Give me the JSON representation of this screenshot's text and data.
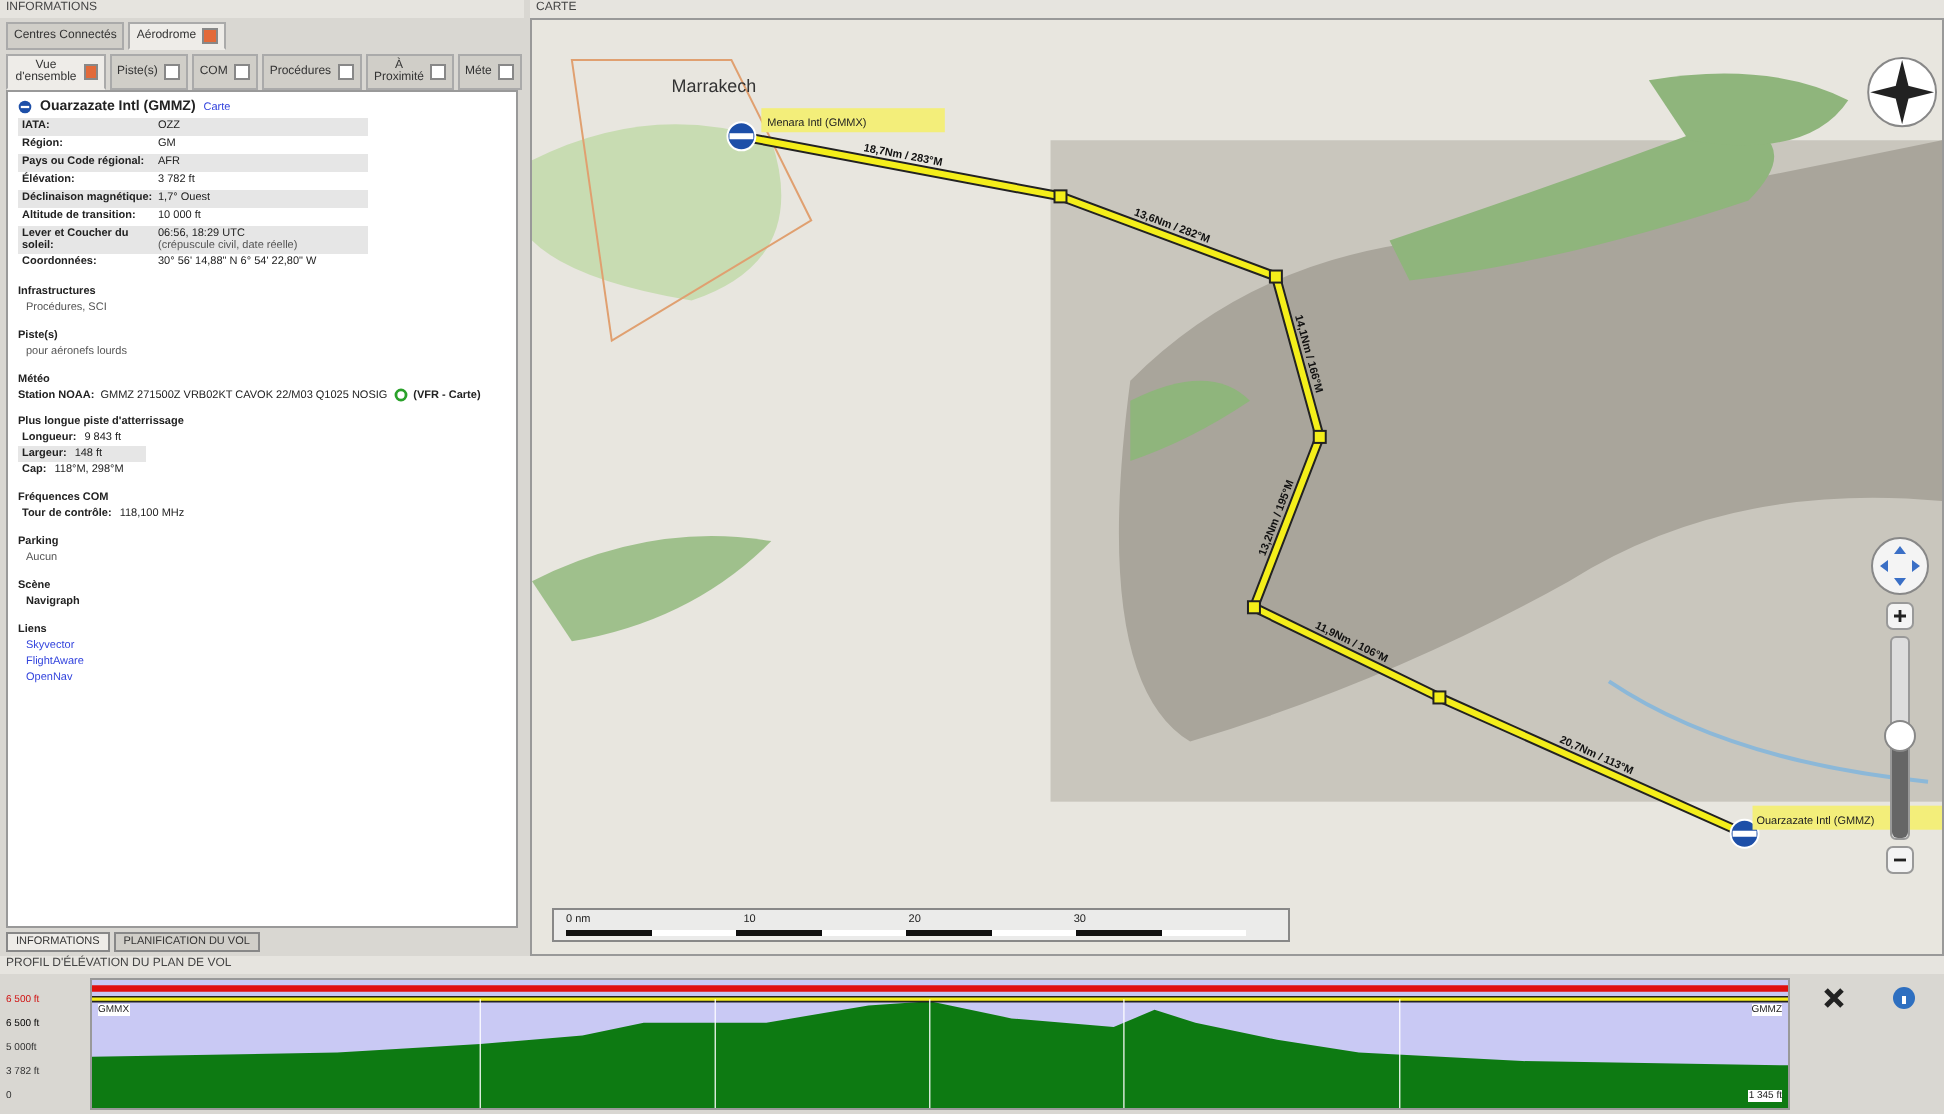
{
  "info_panel": {
    "title": "INFORMATIONS",
    "tabs": [
      {
        "label": "Centres Connectés",
        "selected": false
      },
      {
        "label": "Aérodrome",
        "selected": true
      }
    ],
    "subtabs": [
      {
        "label": "Vue d'ensemble",
        "selected": true
      },
      {
        "label": "Piste(s)",
        "selected": false
      },
      {
        "label": "COM",
        "selected": false
      },
      {
        "label": "Procédures",
        "selected": false
      },
      {
        "label": "À Proximité",
        "selected": false
      },
      {
        "label": "Méte",
        "selected": false
      }
    ],
    "airport": {
      "name": "Ouarzazate Intl (GMMZ)",
      "link": "Carte"
    },
    "rows": [
      {
        "label": "IATA:",
        "value": "OZZ"
      },
      {
        "label": "Région:",
        "value": "GM"
      },
      {
        "label": "Pays ou Code régional:",
        "value": "AFR"
      },
      {
        "label": "Élévation:",
        "value": "3 782 ft"
      },
      {
        "label": "Déclinaison magnétique:",
        "value": "1,7° Ouest"
      },
      {
        "label": "Altitude de transition:",
        "value": "10 000 ft"
      },
      {
        "label": "Lever et Coucher du soleil:",
        "value": "06:56, 18:29 UTC",
        "note": "(crépuscule civil, date réelle)"
      },
      {
        "label": "Coordonnées:",
        "value": "30° 56' 14,88\" N 6° 54' 22,80\" W"
      }
    ],
    "sections": [
      {
        "kind": "plain",
        "heading": "Infrastructures",
        "lines": [
          "Procédures, SCI"
        ]
      },
      {
        "kind": "plain",
        "heading": "Piste(s)",
        "lines": [
          "pour aéronefs lourds"
        ]
      },
      {
        "kind": "metar",
        "heading": "Météo",
        "label": "Station NOAA:",
        "value": "GMMZ 271500Z VRB02KT CAVOK 22/M03 Q1025 NOSIG",
        "flag": "(VFR - Carte)"
      },
      {
        "kind": "table",
        "heading": "Plus longue piste d'atterrissage",
        "rows": [
          {
            "label": "Longueur:",
            "value": "9 843 ft"
          },
          {
            "label": "Largeur:",
            "value": "148 ft"
          },
          {
            "label": "Cap:",
            "value": "118°M, 298°M"
          }
        ]
      },
      {
        "kind": "table",
        "heading": "Fréquences COM",
        "rows": [
          {
            "label": "Tour de contrôle:",
            "value": "118,100 MHz"
          }
        ]
      },
      {
        "kind": "plain",
        "heading": "Parking",
        "lines": [
          "Aucun"
        ]
      },
      {
        "kind": "bold",
        "heading": "Scène",
        "lines": [
          "Navigraph"
        ]
      },
      {
        "kind": "links",
        "heading": "Liens",
        "lines": [
          "Skyvector",
          "FlightAware",
          "OpenNav"
        ]
      }
    ],
    "bottom_tabs": [
      {
        "label": "INFORMATIONS",
        "selected": true
      },
      {
        "label": "PLANIFICATION DU VOL",
        "selected": false
      }
    ]
  },
  "map_panel": {
    "title": "CARTE",
    "city": "Marrakech",
    "departure": {
      "name": "Menara Intl (GMMX)"
    },
    "arrival": {
      "name": "Ouarzazate Intl (GMMZ)"
    },
    "legs": [
      "18,7Nm / 283°M",
      "13,6Nm / 282°M",
      "14,1Nm / 166°M",
      "13,2Nm / 195°M",
      "11,9Nm / 106°M",
      "20,7Nm / 113°M"
    ],
    "scale": [
      "0 nm",
      "10",
      "20",
      "30"
    ],
    "zoom": {
      "level": 0.5
    }
  },
  "profile_panel": {
    "title": "PROFIL D'ÉLÉVATION DU PLAN DE VOL",
    "y_labels": [
      {
        "text": "6 500 ft",
        "kind": "max"
      },
      {
        "text": "6 500 ft",
        "kind": "cruise"
      },
      {
        "text": "5 000ft",
        "kind": "plain"
      },
      {
        "text": "3 782 ft",
        "kind": "plain"
      },
      {
        "text": "0",
        "kind": "plain"
      }
    ],
    "start": "GMMX",
    "end": "GMMZ",
    "end_elevation": "1 345 ft"
  }
}
